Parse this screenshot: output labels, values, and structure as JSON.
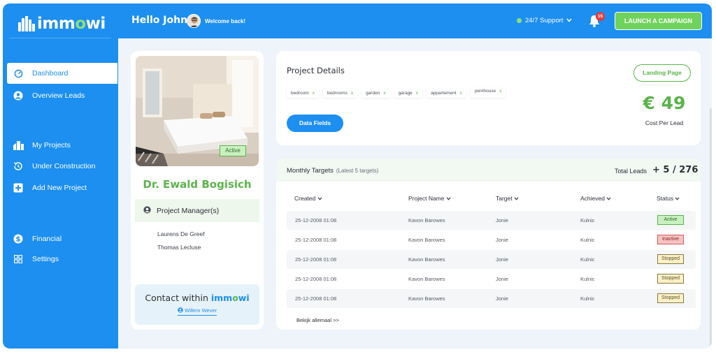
{
  "brand": {
    "logo_text_pre": "imm",
    "logo_text_o": "o",
    "logo_text_post": "wi",
    "accent": "#1c8ff0",
    "green": "#5ab44a"
  },
  "sidebar": {
    "items": [
      {
        "label": "Dashboard",
        "icon": "gauge-icon",
        "active": true
      },
      {
        "label": "Overview Leads",
        "icon": "user-circle-icon"
      },
      {
        "label": "My Projects",
        "icon": "buildings-icon"
      },
      {
        "label": "Under Construction",
        "icon": "history-icon"
      },
      {
        "label": "Add New Project",
        "icon": "plus-square-icon"
      },
      {
        "label": "Financial",
        "icon": "dollar-circle-icon"
      },
      {
        "label": "Settings",
        "icon": "grid-icon"
      }
    ]
  },
  "topbar": {
    "greeting": "Hello John",
    "welcome": "Welcome back!",
    "support": "24/7 Support",
    "notification_count": "15",
    "launch_label": "LAUNCH A CAMPAIGN"
  },
  "profile": {
    "status_badge": "Active",
    "name": "Dr. Ewald Bogisich",
    "pm_title": "Project Manager(s)",
    "managers": [
      "Laurens De Greef",
      "Thomas Lecluse"
    ],
    "contact_title": "Contact within",
    "contact_brand_pre": "imm",
    "contact_brand_o": "o",
    "contact_brand_post": "wi",
    "contact_person": "Willem Wever"
  },
  "details": {
    "title": "Project Details",
    "tags": [
      "bedroom",
      "bedrooms",
      "garden",
      "garage",
      "appartement",
      "penthouse"
    ],
    "tag_remove": "x",
    "data_fields_label": "Data Fields",
    "landing_label": "Landing Page",
    "price": "€ 49",
    "price_label": "Cost Per Lead"
  },
  "targets": {
    "title": "Monthly Targets",
    "subtitle": "(Latest 5 targets)",
    "total_label": "Total Leads",
    "total_value": "+ 5 / 276",
    "columns": [
      "Created",
      "Project Name",
      "Target",
      "Achieved",
      "Status"
    ],
    "rows": [
      {
        "created": "25-12-2008   01:08",
        "project": "Kavon Barowes",
        "target": "Jonie",
        "achieved": "Kulnic",
        "status": "Active"
      },
      {
        "created": "25-12-2008   01:08",
        "project": "Kavon Barowes",
        "target": "Jonie",
        "achieved": "Kulnic",
        "status": "Inactive"
      },
      {
        "created": "25-12-2008   01:08",
        "project": "Kavon Barowes",
        "target": "Jonie",
        "achieved": "Kulnic",
        "status": "Stopped"
      },
      {
        "created": "25-12-2008   01:08",
        "project": "Kavon Barowes",
        "target": "Jonie",
        "achieved": "Kulnic",
        "status": "Stopped"
      },
      {
        "created": "25-12-2008   01:08",
        "project": "Kavon Barowes",
        "target": "Jonie",
        "achieved": "Kulnic",
        "status": "Stopped"
      }
    ],
    "see_all": "Bekijk allemaal >>",
    "status_colors": {
      "Active": {
        "bg": "#c9f0c0",
        "border": "#5ab44a",
        "fg": "#2d6a24"
      },
      "Inactive": {
        "bg": "#f6c2c2",
        "border": "#d45b5b",
        "fg": "#8a2222"
      },
      "Stopped": {
        "bg": "#fbf1c9",
        "border": "#8a7a3a",
        "fg": "#5e531f"
      }
    }
  }
}
